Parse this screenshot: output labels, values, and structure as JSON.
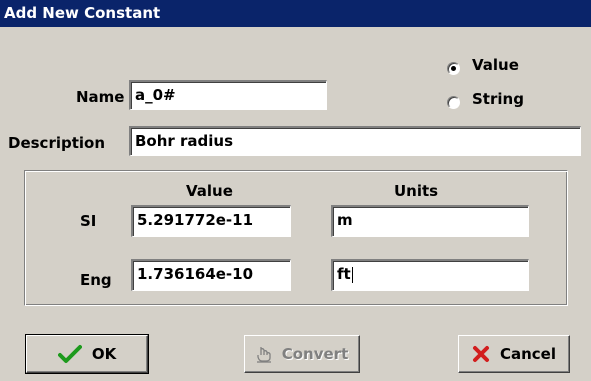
{
  "window": {
    "title": "Add New Constant"
  },
  "form": {
    "name_label": "Name",
    "name_value": "a_0#",
    "description_label": "Description",
    "description_value": "Bohr radius",
    "type_options": [
      {
        "label": "Value",
        "selected": true
      },
      {
        "label": "String",
        "selected": false
      }
    ]
  },
  "values_group": {
    "value_header": "Value",
    "units_header": "Units",
    "rows": [
      {
        "label": "SI",
        "value": "5.291772e-11",
        "units": "m"
      },
      {
        "label": "Eng",
        "value": "1.736164e-10",
        "units": "ft"
      }
    ]
  },
  "buttons": {
    "ok": {
      "label": "OK",
      "icon": "checkmark-icon",
      "color": "#1d9a1d"
    },
    "convert": {
      "label": "Convert",
      "icon": "hand-pointer-icon",
      "enabled": false
    },
    "cancel": {
      "label": "Cancel",
      "icon": "x-mark-icon",
      "color": "#d21e1e"
    }
  }
}
